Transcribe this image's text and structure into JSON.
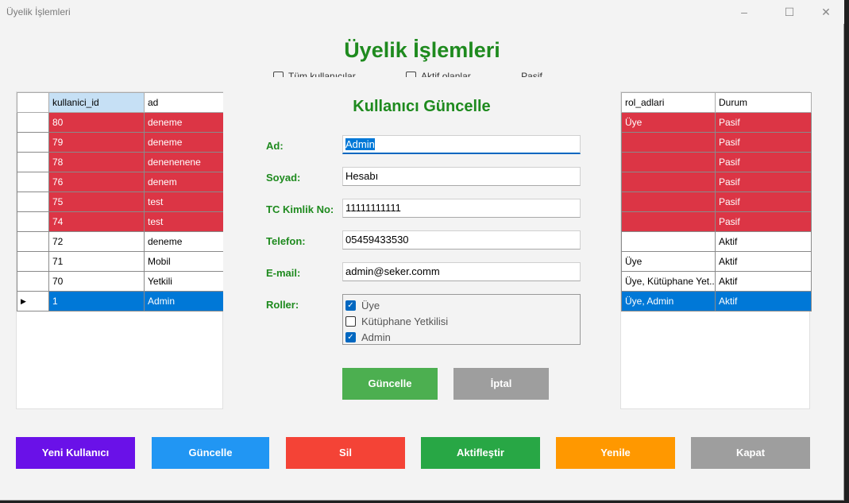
{
  "window": {
    "title": "Üyelik İşlemleri",
    "minimize": "–",
    "maximize": "☐",
    "close": "✕"
  },
  "main_title": "Üyelik İşlemleri",
  "filters": [
    "Tüm kullanıcılar",
    "Aktif olanlar",
    "Pasif olanlar"
  ],
  "left_grid": {
    "columns": [
      "kullanici_id",
      "ad"
    ],
    "rows": [
      {
        "marker": "",
        "id": "80",
        "ad": "deneme",
        "status": "red"
      },
      {
        "marker": "",
        "id": "79",
        "ad": "deneme",
        "status": "red"
      },
      {
        "marker": "",
        "id": "78",
        "ad": "denenenene",
        "status": "red"
      },
      {
        "marker": "",
        "id": "76",
        "ad": "denem",
        "status": "red"
      },
      {
        "marker": "",
        "id": "75",
        "ad": "test",
        "status": "red"
      },
      {
        "marker": "",
        "id": "74",
        "ad": "test",
        "status": "red"
      },
      {
        "marker": "",
        "id": "72",
        "ad": "deneme",
        "status": "white"
      },
      {
        "marker": "",
        "id": "71",
        "ad": "Mobil",
        "status": "white"
      },
      {
        "marker": "",
        "id": "70",
        "ad": "Yetkili",
        "status": "white"
      },
      {
        "marker": "▶",
        "id": "1",
        "ad": "Admin",
        "status": "sel"
      }
    ]
  },
  "right_grid": {
    "columns": [
      "rol_adlari",
      "Durum"
    ],
    "rows": [
      {
        "rol": "Üye",
        "durum": "Pasif",
        "status": "red"
      },
      {
        "rol": "",
        "durum": "Pasif",
        "status": "red"
      },
      {
        "rol": "",
        "durum": "Pasif",
        "status": "red"
      },
      {
        "rol": "",
        "durum": "Pasif",
        "status": "red"
      },
      {
        "rol": "",
        "durum": "Pasif",
        "status": "red"
      },
      {
        "rol": "",
        "durum": "Pasif",
        "status": "red"
      },
      {
        "rol": "",
        "durum": "Aktif",
        "status": "white"
      },
      {
        "rol": "Üye",
        "durum": "Aktif",
        "status": "white"
      },
      {
        "rol": "Üye, Kütüphane Yet...",
        "durum": "Aktif",
        "status": "white"
      },
      {
        "rol": "Üye, Admin",
        "durum": "Aktif",
        "status": "sel"
      }
    ]
  },
  "form": {
    "title": "Kullanıcı Güncelle",
    "ad_label": "Ad:",
    "ad_value": "Admin",
    "soyad_label": "Soyad:",
    "soyad_value": "Hesabı",
    "tc_label": "TC Kimlik No:",
    "tc_value": "11111111111",
    "tel_label": "Telefon:",
    "tel_value": "05459433530",
    "email_label": "E-mail:",
    "email_value": "admin@seker.comm",
    "roles_label": "Roller:",
    "roles": [
      {
        "label": "Üye",
        "checked": true
      },
      {
        "label": "Kütüphane Yetkilisi",
        "checked": false
      },
      {
        "label": "Admin",
        "checked": true
      }
    ],
    "update_button": "Güncelle",
    "cancel_button": "İptal"
  },
  "bottom_buttons": [
    {
      "label": "Yeni Kullanıcı",
      "color": "#6a11e8"
    },
    {
      "label": "Güncelle",
      "color": "#2196f3"
    },
    {
      "label": "Sil",
      "color": "#f44336"
    },
    {
      "label": "Aktifleştir",
      "color": "#28a745"
    },
    {
      "label": "Yenile",
      "color": "#ff9800"
    },
    {
      "label": "Kapat",
      "color": "#9e9e9e"
    }
  ],
  "colors": {
    "title_green": "#1e8a1e",
    "row_red": "#dc3545",
    "row_selected": "#0078d7",
    "update_green": "#4caf50",
    "cancel_gray": "#9e9e9e"
  }
}
